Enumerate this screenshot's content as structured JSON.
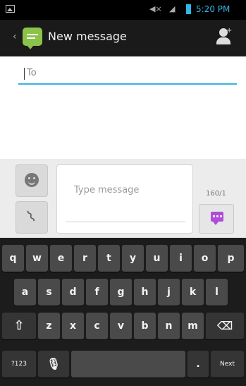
{
  "status_bar": {
    "time": "5:20 PM",
    "icons": [
      "image-icon",
      "mute-icon",
      "signal-icon",
      "battery-icon"
    ]
  },
  "action_bar": {
    "title": "New message",
    "app_icon": "messaging-icon",
    "contact_icon": "add-contact-icon"
  },
  "recipient": {
    "placeholder": "To"
  },
  "compose": {
    "placeholder": "Type message",
    "counter": "160/1",
    "emoji_icon": "smiley-icon",
    "attach_icon": "paperclip-icon",
    "send_icon": "send-icon"
  },
  "keyboard": {
    "row1": [
      "q",
      "w",
      "e",
      "r",
      "t",
      "y",
      "u",
      "i",
      "o",
      "p"
    ],
    "row2": [
      "a",
      "s",
      "d",
      "f",
      "g",
      "h",
      "j",
      "k",
      "l"
    ],
    "row3": [
      "z",
      "x",
      "c",
      "v",
      "b",
      "n",
      "m"
    ],
    "symbols_label": "?123",
    "next_label": "Next",
    "period": "."
  },
  "colors": {
    "accent": "#33b5e5",
    "send": "#b04bdc",
    "app_icon": "#8bc34a"
  }
}
